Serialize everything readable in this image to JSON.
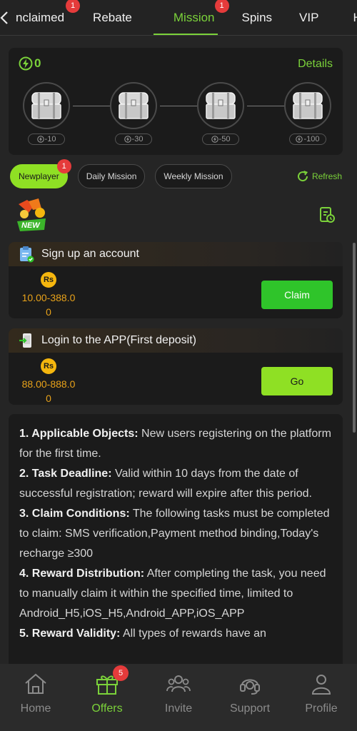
{
  "tabs": [
    {
      "label": "nclaimed",
      "badge": "1"
    },
    {
      "label": "Rebate"
    },
    {
      "label": "Mission",
      "badge": "1",
      "active": true
    },
    {
      "label": "Spins"
    },
    {
      "label": "VIP"
    },
    {
      "label": "H"
    }
  ],
  "chest_panel": {
    "energy": "0",
    "details_label": "Details",
    "chests": [
      {
        "number": "1",
        "cost": "-10"
      },
      {
        "number": "2",
        "cost": "-30"
      },
      {
        "number": "3",
        "cost": "-50"
      },
      {
        "number": "4",
        "cost": "-100"
      }
    ]
  },
  "mission_tabs": [
    {
      "label": "Newplayer",
      "badge": "1",
      "active": true
    },
    {
      "label": "Daily Mission"
    },
    {
      "label": "Weekly Mission"
    }
  ],
  "refresh_label": "Refresh",
  "new_logo_text": "NEW",
  "tasks": [
    {
      "title": "Sign up an account",
      "coin": "Rs",
      "reward_line1": "10.00-388.0",
      "reward_line2": "0",
      "button": "Claim",
      "button_style": "claim"
    },
    {
      "title": "Login to the APP(First deposit)",
      "coin": "Rs",
      "reward_line1": "88.00-888.0",
      "reward_line2": "0",
      "button": "Go",
      "button_style": "go"
    }
  ],
  "rules": [
    {
      "head": "1. Applicable Objects:",
      "text": " New users registering on the platform for the first time."
    },
    {
      "head": "2. Task Deadline:",
      "text": " Valid within 10 days from the date of successful registration; reward will expire after this period."
    },
    {
      "head": "3. Claim Conditions:",
      "text": " The following tasks must be completed to claim: SMS verification,Payment method binding,Today's recharge ≥300"
    },
    {
      "head": "4. Reward Distribution:",
      "text": " After completing the task, you need to manually claim it within the specified time, limited to Android_H5,iOS_H5,Android_APP,iOS_APP"
    },
    {
      "head": "5. Reward Validity:",
      "text": " All types of rewards have an"
    }
  ],
  "bottom_nav": [
    {
      "label": "Home",
      "icon": "home-icon"
    },
    {
      "label": "Offers",
      "icon": "gift-icon",
      "badge": "5",
      "active": true
    },
    {
      "label": "Invite",
      "icon": "invite-icon"
    },
    {
      "label": "Support",
      "icon": "headset-icon"
    },
    {
      "label": "Profile",
      "icon": "profile-icon"
    }
  ],
  "colors": {
    "accent": "#7bd23a",
    "claim": "#2fc42a",
    "coin": "#f5b60e",
    "badge": "#e53b3b"
  }
}
